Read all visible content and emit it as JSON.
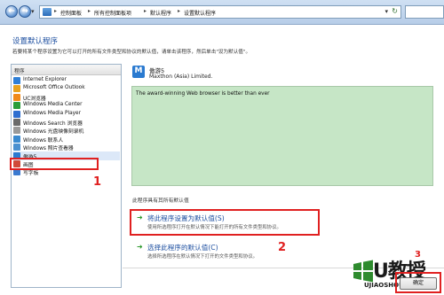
{
  "address_bar": {
    "crumbs": [
      "控制面板",
      "所有控制面板项",
      "默认程序",
      "设置默认程序"
    ]
  },
  "page": {
    "title": "设置默认程序",
    "description": "若要将某个程序设置为它可以打开的所有文件类型和协议的默认值，请单击该程序，然后单击\"设为默认值\"。"
  },
  "program_list": {
    "header": "程序",
    "items": [
      {
        "label": "Internet Explorer",
        "icon": "ie-icon",
        "color": "#2f7fd6"
      },
      {
        "label": "Microsoft Office Outlook",
        "icon": "outlook-icon",
        "color": "#e8a21e"
      },
      {
        "label": "UC浏览器",
        "icon": "uc-icon",
        "color": "#f08a1a"
      },
      {
        "label": "Windows Media Center",
        "icon": "media-center-icon",
        "color": "#2a9d3a"
      },
      {
        "label": "Windows Media Player",
        "icon": "media-player-icon",
        "color": "#2f6fd0"
      },
      {
        "label": "Windows Search 浏览器",
        "icon": "search-icon",
        "color": "#6a6a6a"
      },
      {
        "label": "Windows 光盘映像刻录机",
        "icon": "disc-burner-icon",
        "color": "#9a9a9a"
      },
      {
        "label": "Windows 联系人",
        "icon": "contacts-icon",
        "color": "#3a8ad0"
      },
      {
        "label": "Windows 照片查看器",
        "icon": "photo-viewer-icon",
        "color": "#4a90d0"
      },
      {
        "label": "傲游5",
        "icon": "maxthon-icon",
        "color": "#2a7ad0"
      },
      {
        "label": "画图",
        "icon": "paint-icon",
        "color": "#d04a3a"
      },
      {
        "label": "写字板",
        "icon": "wordpad-icon",
        "color": "#3a7ad0"
      }
    ]
  },
  "selected_program": {
    "name": "傲游5",
    "publisher": "Maxthon (Asia) Limited.",
    "description": "The award-winning Web browser is better than ever",
    "defaults_status": "此程序具有其所有默认值"
  },
  "options": [
    {
      "title": "将此程序设置为默认值(S)",
      "subtitle": "使用所选程序打开在默认情况下能打开的所有文件类型和协议。"
    },
    {
      "title": "选择此程序的默认值(C)",
      "subtitle": "选择所选程序在默认情况下打开的文件类型和协议。"
    }
  ],
  "ok_button": "确定",
  "annotations": [
    "1",
    "2",
    "3"
  ],
  "watermark": {
    "text": "U教授",
    "url": "UJIAOSHOU.COM"
  },
  "colors": {
    "highlight": "#e02020",
    "link": "#1d4fa0",
    "description_bg": "#c6e6c6"
  }
}
